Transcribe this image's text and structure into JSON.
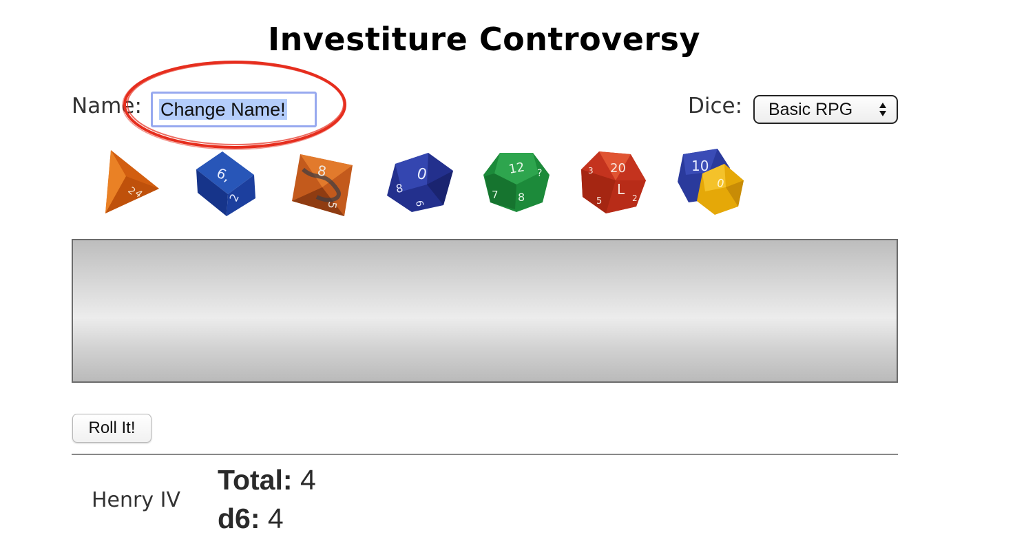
{
  "title": "Investiture Controversy",
  "name_field": {
    "label": "Name:",
    "value": "Change Name!"
  },
  "dice_selector": {
    "label": "Dice:",
    "selected": "Basic RPG"
  },
  "dice": [
    {
      "type": "d4",
      "color": "#d9620f",
      "icon": "d4-die-icon"
    },
    {
      "type": "d6",
      "color": "#1d3e9a",
      "icon": "d6-die-icon"
    },
    {
      "type": "d8",
      "color": "#c95a1c",
      "icon": "d8-die-icon"
    },
    {
      "type": "d10",
      "color": "#26308f",
      "icon": "d10-die-icon"
    },
    {
      "type": "d12",
      "color": "#1e8a3c",
      "icon": "d12-die-icon"
    },
    {
      "type": "d20",
      "color": "#c8331e",
      "icon": "d20-die-icon"
    },
    {
      "type": "d100",
      "color": "#2a3a9c",
      "icon": "percentile-dice-icon"
    }
  ],
  "roll_button": "Roll It!",
  "results": {
    "player": "Henry IV",
    "total_label": "Total:",
    "total_value": "4",
    "d6_label": "d6:",
    "d6_value": "4"
  },
  "colors": {
    "annotation": "#e62e1e",
    "input_focus": "#97a9ef",
    "selection": "#b4cdfb"
  }
}
